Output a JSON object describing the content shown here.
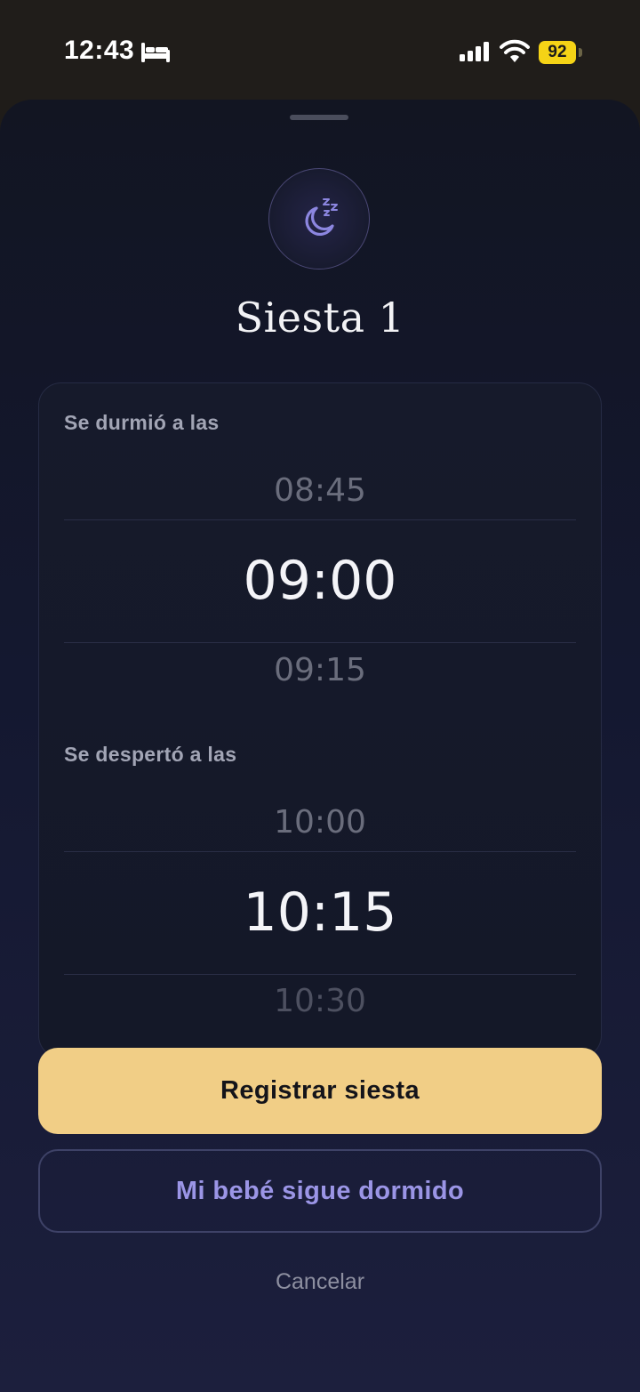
{
  "status_bar": {
    "time": "12:43",
    "battery": "92",
    "icons": [
      "bed-icon",
      "cellular-signal-icon",
      "wifi-icon",
      "battery-icon"
    ]
  },
  "sheet": {
    "icon": "moon-zzz-icon",
    "title": "Siesta 1",
    "fell_asleep": {
      "label": "Se durmió a las",
      "above": "08:45",
      "selected": "09:00",
      "below": "09:15"
    },
    "woke_up": {
      "label": "Se despertó a las",
      "above": "10:00",
      "selected": "10:15",
      "below": "10:30"
    },
    "primary_button": "Registrar siesta",
    "secondary_button": "Mi bebé sigue dormido",
    "cancel": "Cancelar"
  },
  "colors": {
    "accent_yellow": "#f1ce86",
    "accent_purple": "#9b95e6",
    "sheet_background": "#141830",
    "battery_yellow": "#f5d316"
  }
}
